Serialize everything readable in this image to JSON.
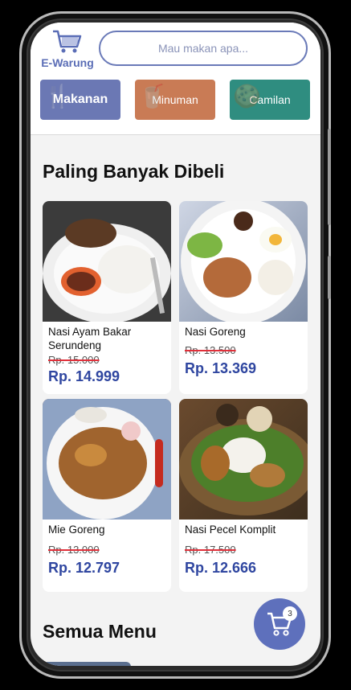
{
  "header": {
    "logo_label": "E-Warung",
    "search_placeholder": "Mau makan apa..."
  },
  "categories": [
    {
      "label": "Makanan",
      "icon": "utensils-icon"
    },
    {
      "label": "Minuman",
      "icon": "drink-icon"
    },
    {
      "label": "Camilan",
      "icon": "snack-icon"
    }
  ],
  "popular": {
    "title": "Paling Banyak Dibeli",
    "items": [
      {
        "name": "Nasi Ayam Bakar Serundeng",
        "old_price": "Rp. 15.000",
        "price": "Rp. 14.999"
      },
      {
        "name": "Nasi Goreng",
        "old_price": "Rp. 13.500",
        "price": "Rp. 13.369"
      },
      {
        "name": "Mie Goreng",
        "old_price": "Rp. 13.000",
        "price": "Rp. 12.797"
      },
      {
        "name": "Nasi Pecel Komplit",
        "old_price": "Rp. 17.500",
        "price": "Rp. 12.666"
      }
    ]
  },
  "all_menu": {
    "title": "Semua Menu"
  },
  "cart": {
    "count": "3",
    "icon": "cart-icon"
  },
  "colors": {
    "brand": "#5a6db6",
    "price": "#2f46a0",
    "makanan": "#6b78b4",
    "minuman": "#c97b55",
    "camilan": "#2f8d80"
  }
}
